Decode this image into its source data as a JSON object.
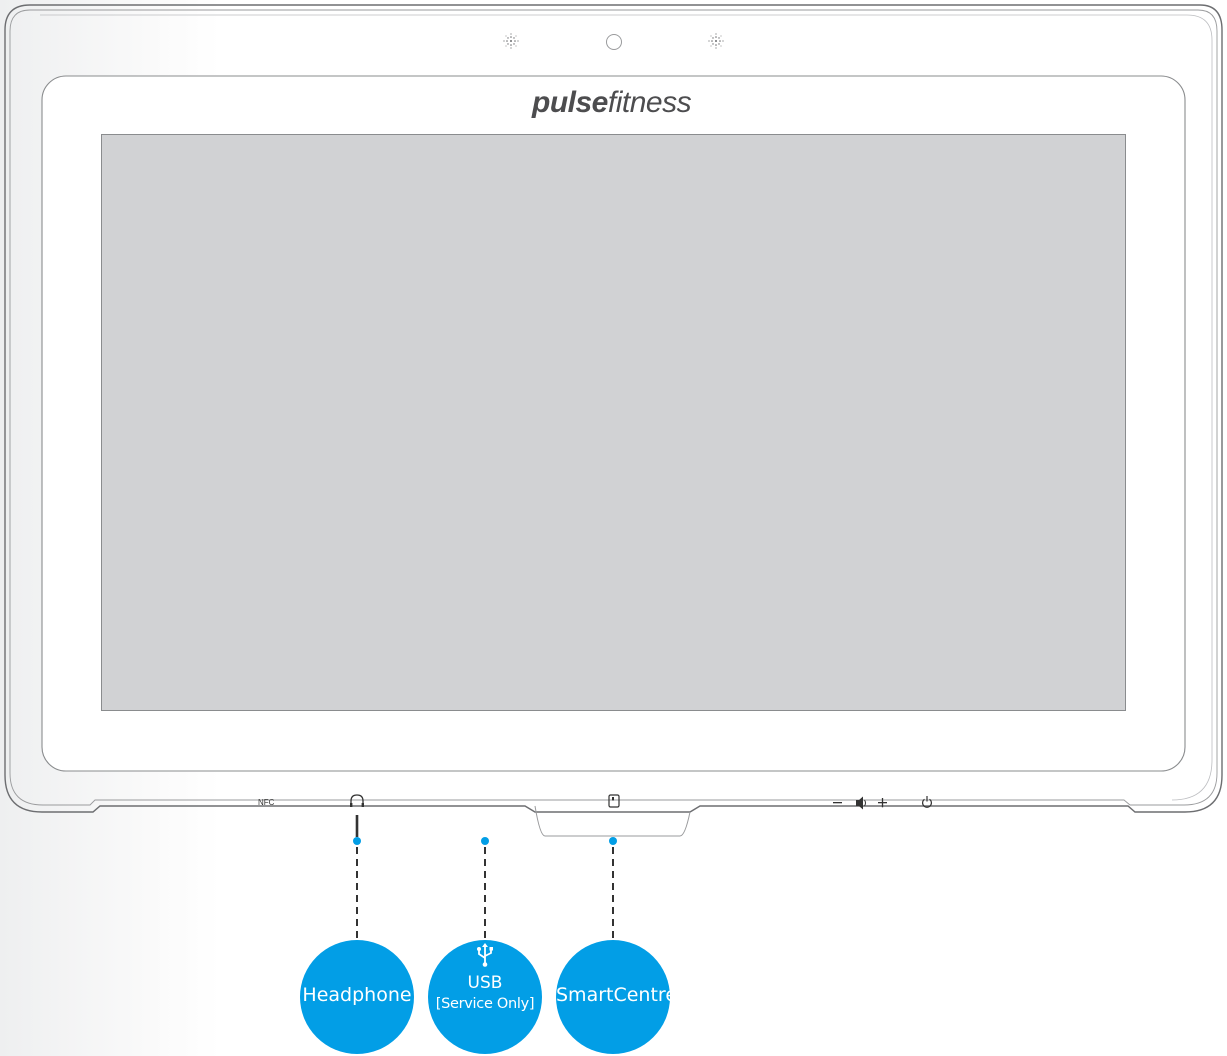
{
  "brand": {
    "bold": "pulse",
    "light": "fitness"
  },
  "bezel": {
    "nfc_label": "NFC"
  },
  "callouts": {
    "headphone": "Headphone",
    "usb": "USB",
    "usb_sub": "[Service Only]",
    "smartcentre": "SmartCentre"
  },
  "colors": {
    "accent": "#029ee6",
    "screen": "#d1d2d4",
    "frame_line": "#8a8c8e"
  },
  "icons": [
    "speaker-grille-icon",
    "camera-icon",
    "headphone-icon",
    "usb-icon",
    "card-reader-icon",
    "volume-icon",
    "power-icon"
  ]
}
